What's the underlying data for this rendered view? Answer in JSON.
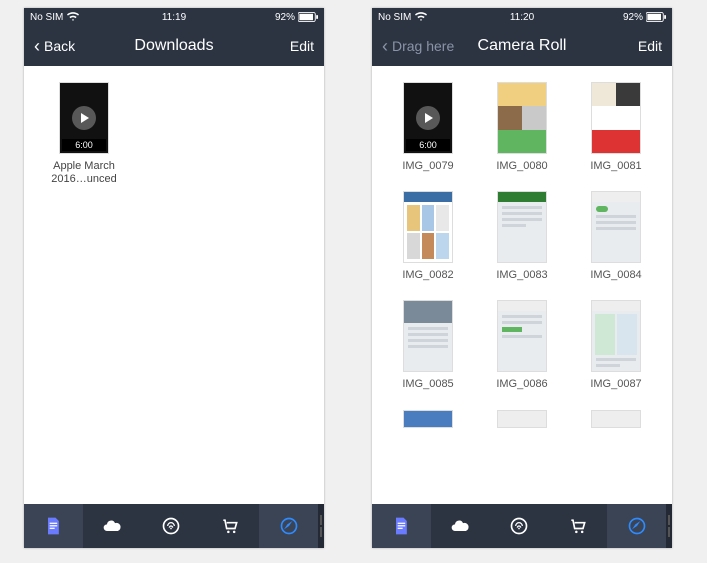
{
  "screens": {
    "left": {
      "status": {
        "carrier": "No SIM",
        "time": "11:19",
        "battery": "92%"
      },
      "nav": {
        "back_label": "Back",
        "title": "Downloads",
        "edit_label": "Edit"
      },
      "items": [
        {
          "label": "Apple March 2016…unced",
          "type": "video",
          "duration": "6:00"
        }
      ]
    },
    "right": {
      "status": {
        "carrier": "No SIM",
        "time": "11:20",
        "battery": "92%"
      },
      "nav": {
        "back_label": "Drag here",
        "title": "Camera Roll",
        "edit_label": "Edit"
      },
      "items": [
        {
          "label": "IMG_0079",
          "type": "video",
          "duration": "6:00"
        },
        {
          "label": "IMG_0080",
          "type": "screenshot"
        },
        {
          "label": "IMG_0081",
          "type": "screenshot"
        },
        {
          "label": "IMG_0082",
          "type": "screenshot"
        },
        {
          "label": "IMG_0083",
          "type": "screenshot"
        },
        {
          "label": "IMG_0084",
          "type": "screenshot"
        },
        {
          "label": "IMG_0085",
          "type": "screenshot"
        },
        {
          "label": "IMG_0086",
          "type": "screenshot"
        },
        {
          "label": "IMG_0087",
          "type": "screenshot"
        }
      ]
    }
  },
  "colors": {
    "chrome": "#2c3442",
    "accent": "#2e8bff",
    "doc_icon": "#6a7bff"
  },
  "tabs": [
    "documents",
    "cloud",
    "wifi-share",
    "cart",
    "browser"
  ]
}
